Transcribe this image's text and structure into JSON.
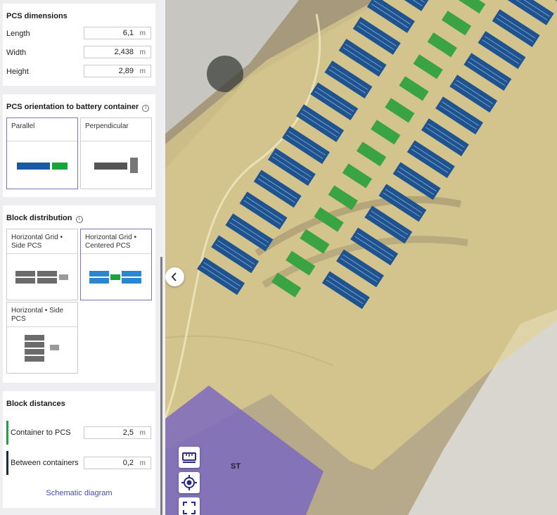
{
  "pcs_dimensions": {
    "title": "PCS dimensions",
    "fields": [
      {
        "label": "Length",
        "value": "6,1",
        "unit": "m"
      },
      {
        "label": "Width",
        "value": "2,438",
        "unit": "m"
      },
      {
        "label": "Height",
        "value": "2,89",
        "unit": "m"
      }
    ]
  },
  "pcs_orientation": {
    "title": "PCS orientation to battery container",
    "options": [
      {
        "label": "Parallel",
        "selected": true
      },
      {
        "label": "Perpendicular",
        "selected": false
      }
    ]
  },
  "block_distribution": {
    "title": "Block distribution",
    "options": [
      {
        "label": "Horizontal Grid • Side PCS",
        "selected": false
      },
      {
        "label": "Horizontal Grid • Centered PCS",
        "selected": true
      },
      {
        "label": "Horizontal • Side PCS",
        "selected": false
      }
    ]
  },
  "block_distances": {
    "title": "Block distances",
    "fields": [
      {
        "label": "Container to PCS",
        "value": "2,5",
        "unit": "m",
        "accent": "#1ea43a"
      },
      {
        "label": "Between containers",
        "value": "0,2",
        "unit": "m",
        "accent": "#1b2a44"
      }
    ],
    "schematic_link": "Schematic diagram"
  },
  "map": {
    "area_label": "ST",
    "controls": [
      "ruler-icon",
      "locate-icon",
      "fullscreen-icon"
    ],
    "colors": {
      "container": "#1e5390",
      "pcs": "#3aa445",
      "site_area": "#e3d38f",
      "st_area": "#7a66c2"
    }
  },
  "colors": {
    "selected_border": "#7876c8",
    "link": "#4a48b8",
    "container_blue": "#1a5aa5",
    "pcs_green": "#18a43c",
    "schematic_gray": "#555555",
    "selected_blue": "#2a86d0"
  }
}
